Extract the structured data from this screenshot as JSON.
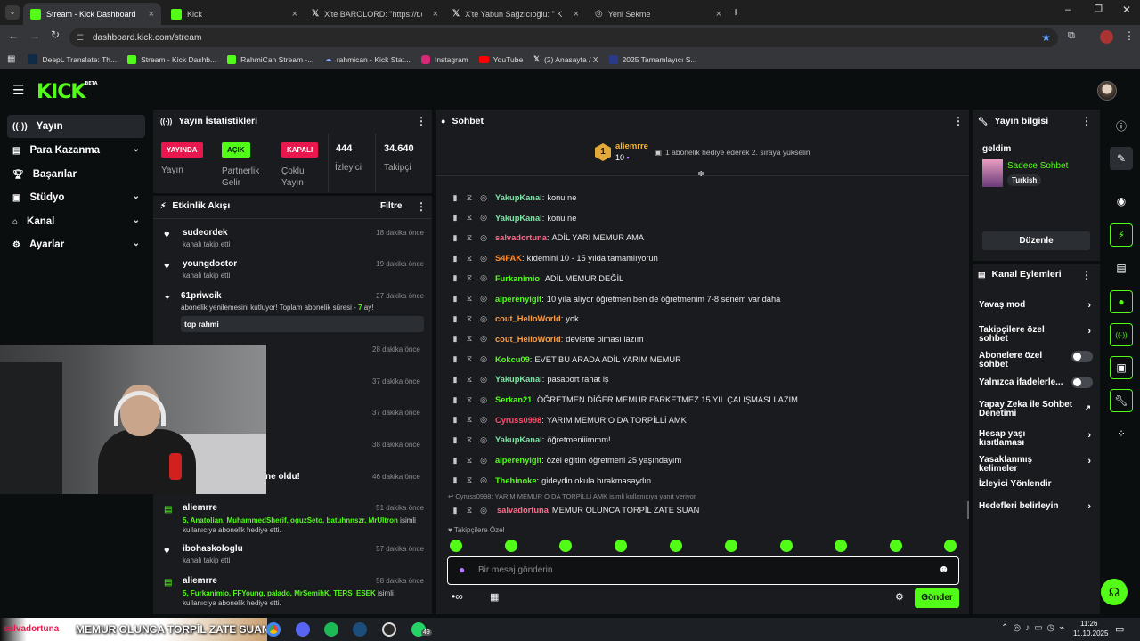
{
  "browser": {
    "tabs": [
      {
        "label": "Stream - Kick Dashboard",
        "active": true
      },
      {
        "label": "Kick"
      },
      {
        "label": "X'te BAROLORD: \"https://t.co/u"
      },
      {
        "label": "X'te Yabun Sağzıcıoğlu: \" KN"
      },
      {
        "label": "Yeni Sekme"
      }
    ],
    "url": "dashboard.kick.com/stream",
    "bookmarks": [
      "DeepL Translate: Th...",
      "Stream - Kick Dashb...",
      "RahmiCan Stream -...",
      "rahmican - Kick Stat...",
      "Instagram",
      "YouTube",
      "(2) Anasayfa / X",
      "2025 Tamamlayıcı S..."
    ]
  },
  "header": {
    "logo": "KICK",
    "beta": "BETA"
  },
  "nav": [
    {
      "label": "Yayın",
      "icon": "broadcast-icon",
      "active": true
    },
    {
      "label": "Para Kazanma",
      "icon": "money-icon",
      "chevron": true
    },
    {
      "label": "Başarılar",
      "icon": "trophy-icon"
    },
    {
      "label": "Stüdyo",
      "icon": "studio-icon",
      "chevron": true
    },
    {
      "label": "Kanal",
      "icon": "home-icon",
      "chevron": true
    },
    {
      "label": "Ayarlar",
      "icon": "gear-icon",
      "chevron": true
    }
  ],
  "stats": {
    "title": "Yayın İstatistikleri",
    "live_badge": "YAYINDA",
    "live_label": "Yayın",
    "partner_badge": "AÇIK",
    "partner_label": "Partnerlik Gelir",
    "multistream_badge": "KAPALI",
    "multistream_label": "Çoklu Yayın",
    "viewers": "444",
    "viewers_label": "İzleyici",
    "followers": "34.640",
    "followers_label": "Takipçi"
  },
  "activity": {
    "title": "Etkinlik Akışı",
    "filter": "Filtre",
    "events": [
      {
        "name": "sudeordek",
        "desc": "kanalı takip etti",
        "time": "18 dakika önce"
      },
      {
        "name": "youngdoctor",
        "desc": "kanalı takip etti",
        "time": "19 dakika önce"
      },
      {
        "name": "61priwcik",
        "desc": "abonelik yenilemesini kutluyor! Toplam abonelik süresi - ",
        "months": "7",
        "months_suffix": " ay!",
        "time": "27 dakika önce",
        "message": "top rahmi"
      },
      {
        "time": "28 dakika önce"
      },
      {
        "time": "37 dakika önce"
      },
      {
        "time": "37 dakika önce"
      },
      {
        "time": "38 dakika önce"
      },
      {
        "partial": "ne oldu!",
        "time": "46 dakika önce"
      },
      {
        "name": "aliemrre",
        "gift_users": "5, Anatolian, MuhammedSherif, oguzSeto, batuhnnszr, MrUltron",
        "gift_suffix": " isimli kullanıcıya abonelik hediye etti.",
        "time": "51 dakika önce"
      },
      {
        "name": "ibohaskologlu",
        "desc": "kanalı takip etti",
        "time": "57 dakika önce"
      },
      {
        "name": "aliemrre",
        "gift_users": "5, Furkanimio, FFYoung, palado, MrSemihK, TERS_ESEK",
        "gift_suffix": " isimli kullanıcıya abonelik hediye etti.",
        "time": "58 dakika önce"
      }
    ]
  },
  "chat": {
    "title": "Sohbet",
    "pinned_user": "aliemrre",
    "pinned_rank": "1",
    "pinned_count": "10",
    "pinned_text": "1 abonelik hediye ederek 2. sıraya yükselin",
    "messages": [
      {
        "user": "YakupKanal",
        "text": "konu ne",
        "color": "#7ee3a5"
      },
      {
        "user": "YakupKanal",
        "text": "konu ne",
        "color": "#7ee3a5"
      },
      {
        "user": "salvadortuna",
        "text": "ADİL YARI MEMUR AMA",
        "color": "#ff6b8a"
      },
      {
        "user": "S4FAK",
        "text": "kıdemini 10 - 15 yılda tamamlıyorun",
        "color": "#ff8c2a"
      },
      {
        "user": "Furkanimio",
        "text": "ADİL MEMUR DEĞİL",
        "color": "#53fc18"
      },
      {
        "user": "alperenyigit",
        "text": "10 yıla alıyor öğretmen ben de öğretmenim 7-8 senem var daha",
        "color": "#53fc18"
      },
      {
        "user": "cout_HelloWorld",
        "text": "yok",
        "color": "#ff9f43"
      },
      {
        "user": "cout_HelloWorld",
        "text": "devlette olması lazım",
        "color": "#ff9f43"
      },
      {
        "user": "Kokcu09",
        "text": "EVET BU ARADA ADİL YARIM MEMUR",
        "color": "#53fc18"
      },
      {
        "user": "YakupKanal",
        "text": "pasaport rahat iş",
        "color": "#7ee3a5"
      },
      {
        "user": "Serkan21",
        "text": "ÖĞRETMEN DİĞER MEMUR FARKETMEZ 15 YIL ÇALIŞMASI LAZIM",
        "color": "#53fc18"
      },
      {
        "user": "Cyruss0998",
        "text": "YARIM MEMUR O DA TORPİLLİ AMK",
        "color": "#ff4d6d"
      },
      {
        "user": "YakupKanal",
        "text": "öğretmeniiimmm!",
        "color": "#7ee3a5"
      },
      {
        "user": "alperenyigit",
        "text": "özel eğitim öğretmeni 25 yaşındayım",
        "color": "#53fc18"
      },
      {
        "user": "Thehinoke",
        "text": "gideydin okula bırakmasaydın",
        "color": "#53fc18"
      }
    ],
    "reply_text": "Cyruss0998: YARIM MEMUR O DA TORPİLLİ AMK isimli kullanıcıya yanıt veriyor",
    "last_message": {
      "user": "salvadortuna",
      "text": "MEMUR OLUNCA TORPİL ZATE SUAN",
      "color": "#ff6b8a"
    },
    "followers_only": "Takipçilere Özel",
    "input_placeholder": "Bir mesaj gönderin",
    "send_label": "Gönder"
  },
  "stream_info": {
    "title": "Yayın bilgisi",
    "stream_title": "geldim",
    "category": "Sadece Sohbet",
    "language": "Turkish",
    "edit_label": "Düzenle"
  },
  "channel_actions": {
    "title": "Kanal Eylemleri",
    "items": [
      {
        "label": "Yavaş mod",
        "type": "arrow"
      },
      {
        "label": "Takipçilere özel sohbet",
        "type": "arrow"
      },
      {
        "label": "Abonelere özel sohbet",
        "type": "toggle"
      },
      {
        "label": "Yalnızca ifadelerle...",
        "type": "toggle"
      },
      {
        "label": "Yapay Zeka ile Sohbet Denetimi",
        "type": "external"
      },
      {
        "label": "Hesap yaşı kısıtlaması",
        "type": "arrow"
      },
      {
        "label": "Yasaklanmış kelimeler",
        "type": "arrow"
      },
      {
        "label": "İzleyici Yönlendir",
        "type": "none"
      },
      {
        "label": "Hedefleri belirleyin",
        "type": "arrow"
      }
    ]
  },
  "overlay_text": "MEMUR OLUNCA TORPİL ZATE SUAN",
  "overlay_user": "salvadortuna",
  "taskbar": {
    "time": "11:26",
    "date": "11.10.2025",
    "whatsapp_badge": "49"
  },
  "colors": {
    "brand": "#53fc18",
    "panel": "#191b1f",
    "bg": "#0b0e0f",
    "live": "#e8174e",
    "closed": "#e8174e"
  }
}
